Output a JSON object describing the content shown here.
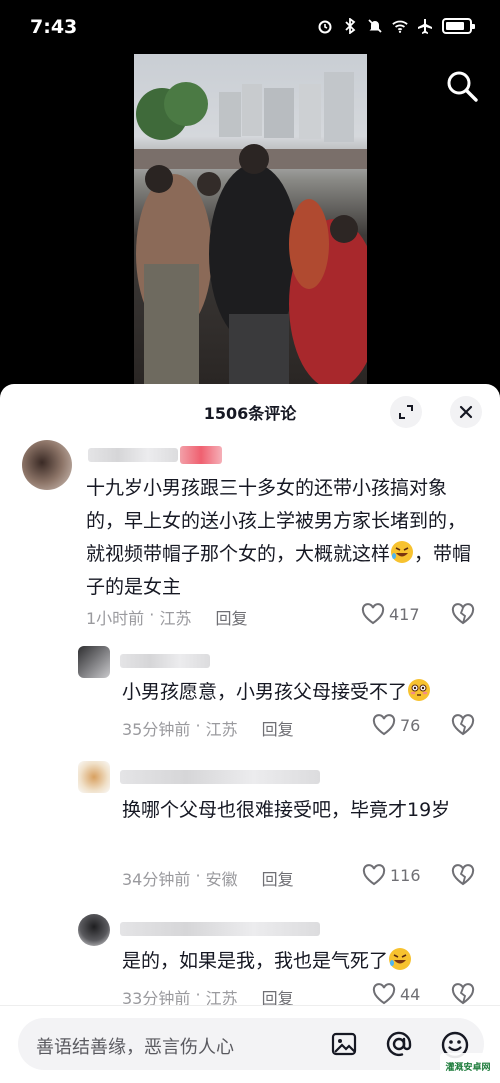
{
  "status_bar": {
    "time": "7:43",
    "battery_level": 0.8
  },
  "sheet": {
    "title": "1506条评论"
  },
  "comments": [
    {
      "text": "十九岁小男孩跟三十多女的还带小孩搞对象的，早上女的送小孩上学被男方家长堵到的，就视频带帽子那个女的，大概就这样",
      "text_after_emoji": "，带帽子的是女主",
      "emoji": "rofl-emoji",
      "time": "1小时前",
      "location": "江苏",
      "reply_label": "回复",
      "likes": "417"
    },
    {
      "text": "小男孩愿意，小男孩父母接受不了",
      "emoji": "flushed-emoji",
      "time": "35分钟前",
      "location": "江苏",
      "reply_label": "回复",
      "likes": "76"
    },
    {
      "text": "换哪个父母也很难接受吧，毕竟才19岁",
      "time": "34分钟前",
      "location": "安徽",
      "reply_label": "回复",
      "likes": "116"
    },
    {
      "text": "是的，如果是我，我也是气死了",
      "emoji": "rofl-emoji",
      "time": "33分钟前",
      "location": "江苏",
      "reply_label": "回复",
      "likes": "44"
    }
  ],
  "input": {
    "placeholder": "善语结善缘，恶言伤人心"
  },
  "watermark": "灌溉安卓网",
  "colors": {
    "like_icon": "#6f6f74",
    "text": "#161823",
    "meta": "#9a9a9e",
    "sheet_bg": "#ffffff"
  }
}
